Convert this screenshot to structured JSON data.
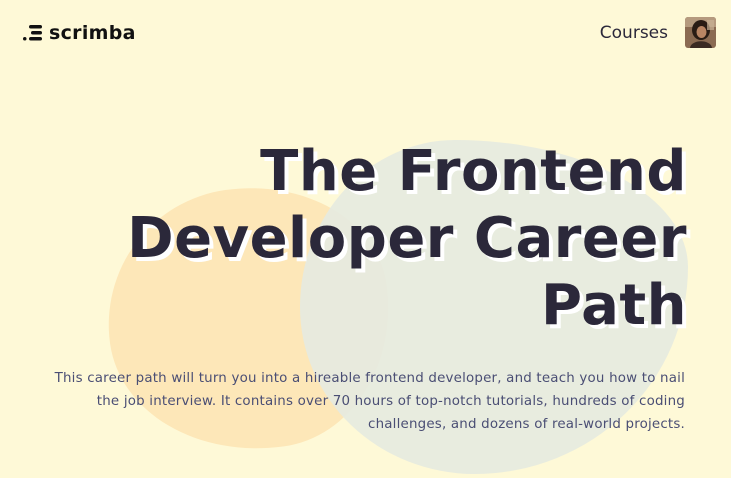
{
  "header": {
    "logo_text": "scrimba",
    "nav": {
      "courses_label": "Courses"
    }
  },
  "hero": {
    "title_line1": "The Frontend",
    "title_line2": "Developer Career",
    "title_line3": "Path",
    "description": "This career path will turn you into a hireable frontend developer, and teach you how to nail the job interview. It contains over 70 hours of top-notch tutorials, hundreds of coding challenges, and dozens of real-world projects."
  },
  "icons": {
    "logo": "scrimba-logo-icon",
    "avatar": "user-avatar"
  },
  "colors": {
    "background": "#FEF9D7",
    "text_dark": "#2B283A",
    "text_body": "#4A4E74",
    "blob_orange": "#FDE7B8",
    "blob_gray": "#E6EAE0"
  }
}
